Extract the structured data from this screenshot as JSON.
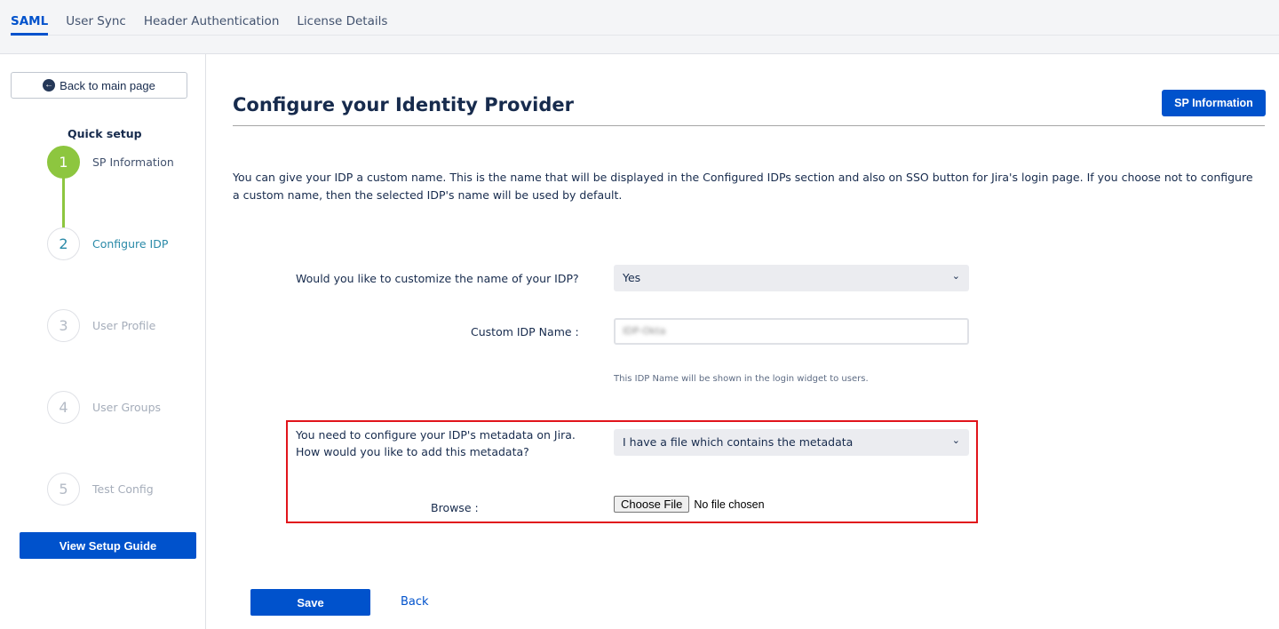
{
  "tabs": [
    {
      "label": "SAML",
      "active": true
    },
    {
      "label": "User Sync"
    },
    {
      "label": "Header Authentication"
    },
    {
      "label": "License Details"
    }
  ],
  "sidebar": {
    "back_label": "Back to main page",
    "quick_setup": "Quick setup",
    "steps": [
      {
        "num": "1",
        "label": "SP Information",
        "state": "done"
      },
      {
        "num": "2",
        "label": "Configure IDP",
        "state": "current"
      },
      {
        "num": "3",
        "label": "User Profile"
      },
      {
        "num": "4",
        "label": "User Groups"
      },
      {
        "num": "5",
        "label": "Test Config"
      }
    ],
    "guide_label": "View Setup Guide"
  },
  "main": {
    "title": "Configure your Identity Provider",
    "sp_info_button": "SP Information",
    "description": "You can give your IDP a custom name. This is the name that will be displayed in the Configured IDPs section and also on SSO button for Jira's login page. If you choose not to configure a custom name, then the selected IDP's name will be used by default.",
    "customize_label": "Would you like to customize the name of your IDP?",
    "customize_value": "Yes",
    "custom_name_label": "Custom IDP Name :",
    "custom_name_value": "IDP-Okta",
    "custom_name_hint": "This IDP Name will be shown in the login widget to users.",
    "metadata_label_1": "You need to configure your IDP's metadata on Jira.",
    "metadata_label_2": "How would you like to add this metadata?",
    "metadata_value": "I have a file which contains the metadata",
    "browse_label": "Browse :",
    "choose_file": "Choose File",
    "no_file": "No file chosen",
    "save": "Save",
    "back": "Back"
  },
  "colors": {
    "primary": "#0052cc",
    "step_done": "#8dc63f",
    "highlight": "#e1141b"
  }
}
